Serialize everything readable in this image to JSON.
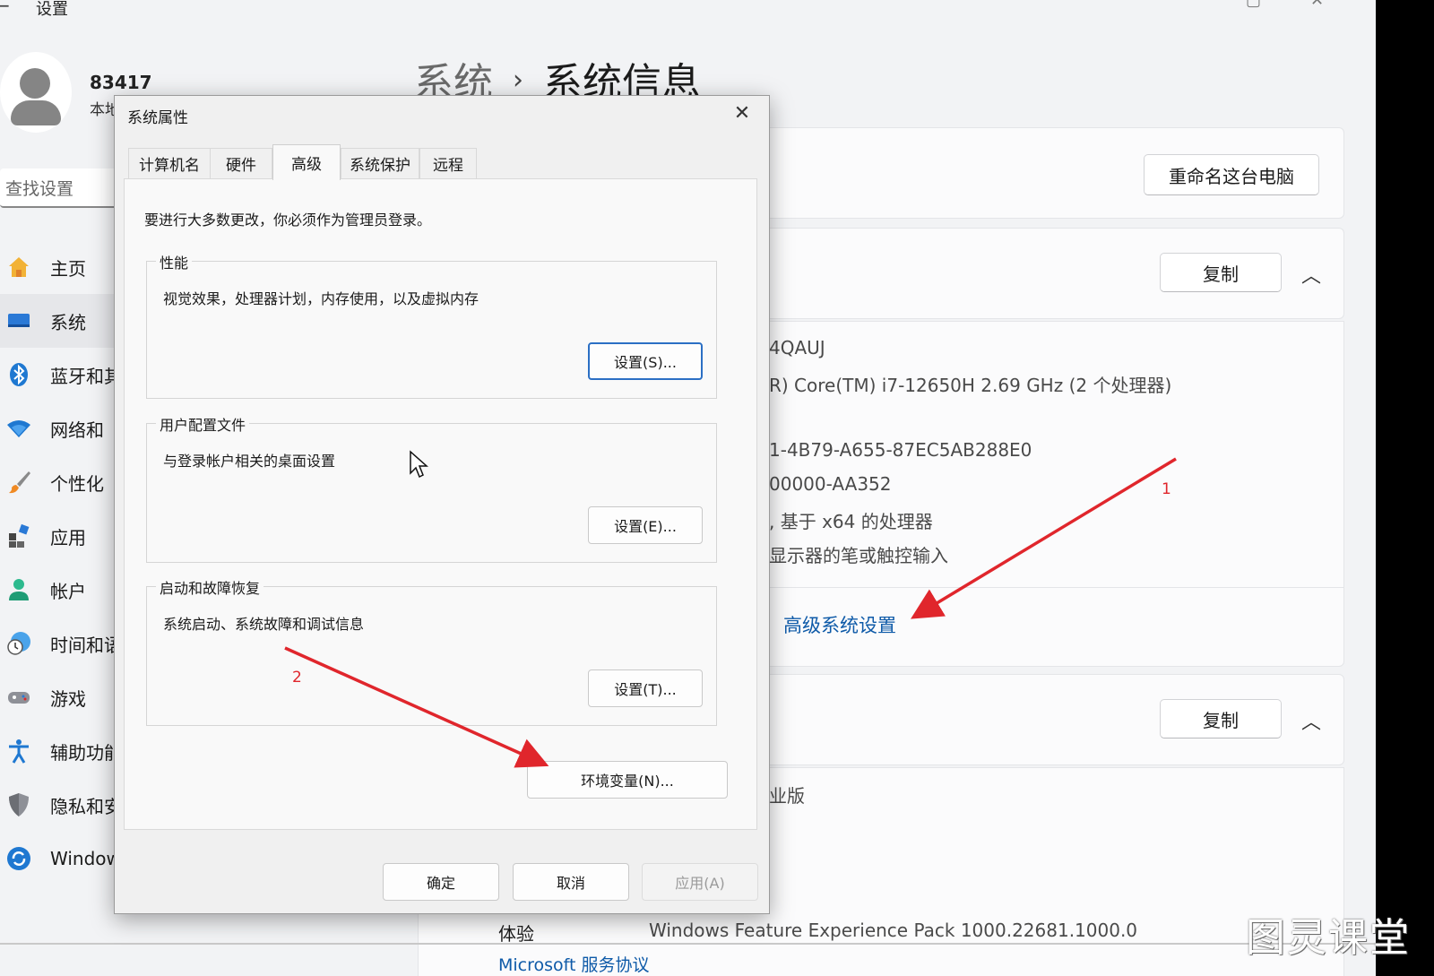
{
  "app": {
    "title": "设置"
  },
  "account": {
    "name": "83417",
    "type": "本地"
  },
  "search": {
    "placeholder": "查找设置"
  },
  "nav": [
    {
      "label": "主页",
      "icon": "home-icon"
    },
    {
      "label": "系统",
      "icon": "monitor-icon"
    },
    {
      "label": "蓝牙和其",
      "icon": "bluetooth-icon"
    },
    {
      "label": "网络和",
      "icon": "wifi-icon"
    },
    {
      "label": "个性化",
      "icon": "brush-icon"
    },
    {
      "label": "应用",
      "icon": "apps-icon"
    },
    {
      "label": "帐户",
      "icon": "person-icon"
    },
    {
      "label": "时间和语",
      "icon": "clock-globe-icon"
    },
    {
      "label": "游戏",
      "icon": "gamepad-icon"
    },
    {
      "label": "辅助功能",
      "icon": "accessibility-icon"
    },
    {
      "label": "隐私和安",
      "icon": "shield-icon"
    },
    {
      "label": "Windows",
      "icon": "windows-update-icon"
    }
  ],
  "breadcrumb": {
    "parent": "系统",
    "separator": "›",
    "current": "系统信息"
  },
  "right": {
    "rename_button": "重命名这台电脑",
    "copy_button_1": "复制",
    "copy_button_2": "复制",
    "specs": [
      "4QAUJ",
      "R) Core(TM) i7-12650H   2.69 GHz  (2 个处理器)",
      "1-4B79-A655-87EC5AB288E0",
      "00000-AA352",
      ", 基于 x64 的处理器",
      "显示器的笔或触控输入"
    ],
    "advanced_link": "高级系统设置",
    "edition_fragment": "业版",
    "experience_label": "体验",
    "experience_value": "Windows Feature Experience Pack 1000.22681.1000.0",
    "service_agreement": "Microsoft 服务协议"
  },
  "dialog": {
    "title": "系统属性",
    "tabs": [
      "计算机名",
      "硬件",
      "高级",
      "系统保护",
      "远程"
    ],
    "active_tab": "高级",
    "admin_notice": "要进行大多数更改，你必须作为管理员登录。",
    "performance": {
      "title": "性能",
      "desc": "视觉效果，处理器计划，内存使用，以及虚拟内存",
      "button": "设置(S)..."
    },
    "user_profiles": {
      "title": "用户配置文件",
      "desc": "与登录帐户相关的桌面设置",
      "button": "设置(E)..."
    },
    "startup_recovery": {
      "title": "启动和故障恢复",
      "desc": "系统启动、系统故障和调试信息",
      "button": "设置(T)..."
    },
    "env_button": "环境变量(N)...",
    "ok": "确定",
    "cancel": "取消",
    "apply": "应用(A)"
  },
  "annotations": {
    "marker_1": "1",
    "marker_2": "2",
    "color": "#e0262c"
  },
  "watermark": "图灵课堂"
}
